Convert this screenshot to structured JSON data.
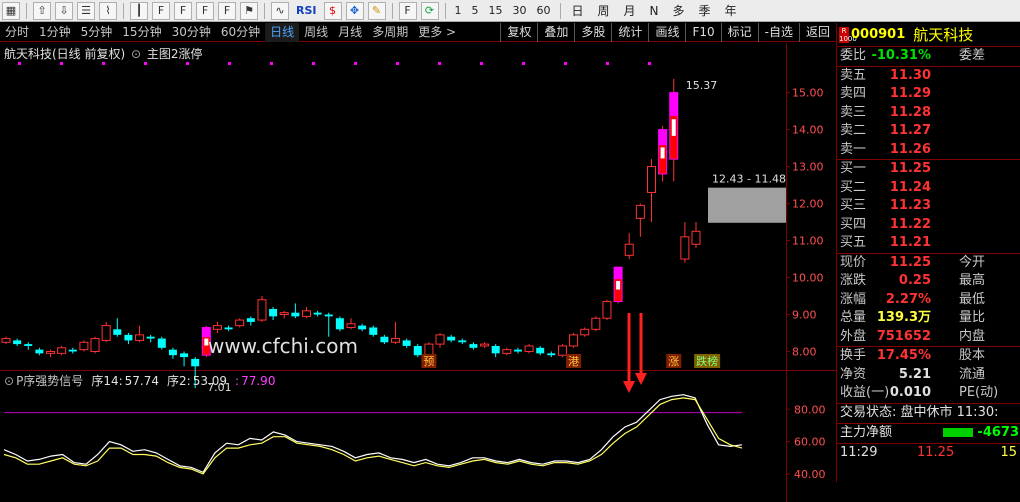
{
  "toolbar": {
    "icons": [
      "grid-icon",
      "arrow-up-icon",
      "arrow-down-icon",
      "list-icon",
      "line-chart-icon",
      "candle-icon",
      "f10-icon",
      "fa-icon",
      "fz-icon",
      "fc-icon",
      "flag-icon",
      "sparkline-icon",
      "rsi-icon",
      "dollar-icon",
      "move-icon",
      "pencil-icon",
      "f5-icon",
      "refresh-icon"
    ],
    "rsi_label": "RSI",
    "periods": [
      "1",
      "5",
      "15",
      "30",
      "60"
    ],
    "ranges": [
      "日",
      "周",
      "月",
      "N",
      "多",
      "季",
      "年"
    ]
  },
  "period_bar": {
    "items": [
      "分时",
      "1分钟",
      "5分钟",
      "15分钟",
      "30分钟",
      "60分钟",
      "日线",
      "周线",
      "月线",
      "多周期",
      "更多 >"
    ],
    "active_index": 6,
    "buttons": [
      "复权",
      "叠加",
      "多股",
      "统计",
      "画线",
      "F10",
      "标记",
      "-自选",
      "返回"
    ]
  },
  "chart_header": {
    "stock_title": "航天科技(日线 前复权)",
    "main_label": "主图2涨停"
  },
  "watermark": "www.cfchi.com",
  "chart_data": {
    "type": "candlestick",
    "price_axis": {
      "ticks": [
        "15.00",
        "14.00",
        "13.00",
        "12.00",
        "11.00",
        "10.00",
        "9.00",
        "8.00"
      ],
      "ylim": [
        7.5,
        15.8
      ]
    },
    "high_label": "15.37",
    "low_label": "7.01",
    "gap_label": "12.43 - 11.48",
    "gap_range": [
      11.48,
      12.43
    ],
    "markers": [
      "预",
      "港",
      "涨",
      "跌榜"
    ],
    "candles": [
      {
        "o": 8.25,
        "c": 8.35,
        "h": 8.4,
        "l": 8.2
      },
      {
        "o": 8.3,
        "c": 8.2,
        "h": 8.35,
        "l": 8.15
      },
      {
        "o": 8.2,
        "c": 8.15,
        "h": 8.25,
        "l": 8.05
      },
      {
        "o": 8.05,
        "c": 7.95,
        "h": 8.1,
        "l": 7.9
      },
      {
        "o": 7.95,
        "c": 8.0,
        "h": 8.05,
        "l": 7.85
      },
      {
        "o": 7.95,
        "c": 8.1,
        "h": 8.15,
        "l": 7.9
      },
      {
        "o": 8.05,
        "c": 8.0,
        "h": 8.1,
        "l": 7.95
      },
      {
        "o": 8.05,
        "c": 8.25,
        "h": 8.3,
        "l": 8.0
      },
      {
        "o": 8.0,
        "c": 8.35,
        "h": 8.4,
        "l": 7.95
      },
      {
        "o": 8.3,
        "c": 8.7,
        "h": 8.8,
        "l": 8.25
      },
      {
        "o": 8.6,
        "c": 8.45,
        "h": 8.9,
        "l": 8.4
      },
      {
        "o": 8.45,
        "c": 8.3,
        "h": 8.5,
        "l": 8.2
      },
      {
        "o": 8.3,
        "c": 8.45,
        "h": 8.7,
        "l": 8.25
      },
      {
        "o": 8.4,
        "c": 8.35,
        "h": 8.45,
        "l": 8.25
      },
      {
        "o": 8.35,
        "c": 8.1,
        "h": 8.4,
        "l": 8.05
      },
      {
        "o": 8.05,
        "c": 7.9,
        "h": 8.1,
        "l": 7.8
      },
      {
        "o": 7.95,
        "c": 7.85,
        "h": 8.0,
        "l": 7.6
      },
      {
        "o": 7.8,
        "c": 7.6,
        "h": 7.85,
        "l": 7.01
      },
      {
        "o": 7.9,
        "c": 8.65,
        "h": 8.7,
        "l": 7.85
      },
      {
        "o": 8.6,
        "c": 8.7,
        "h": 8.8,
        "l": 8.5
      },
      {
        "o": 8.65,
        "c": 8.6,
        "h": 8.7,
        "l": 8.55
      },
      {
        "o": 8.7,
        "c": 8.85,
        "h": 8.9,
        "l": 8.65
      },
      {
        "o": 8.9,
        "c": 8.8,
        "h": 8.95,
        "l": 8.7
      },
      {
        "o": 8.85,
        "c": 9.4,
        "h": 9.5,
        "l": 8.8
      },
      {
        "o": 9.15,
        "c": 8.95,
        "h": 9.2,
        "l": 8.85
      },
      {
        "o": 9.0,
        "c": 9.05,
        "h": 9.1,
        "l": 8.9
      },
      {
        "o": 9.05,
        "c": 8.95,
        "h": 9.3,
        "l": 8.9
      },
      {
        "o": 8.95,
        "c": 9.1,
        "h": 9.2,
        "l": 8.9
      },
      {
        "o": 9.05,
        "c": 9.0,
        "h": 9.1,
        "l": 8.95
      },
      {
        "o": 9.0,
        "c": 8.95,
        "h": 9.05,
        "l": 8.4
      },
      {
        "o": 8.9,
        "c": 8.6,
        "h": 8.95,
        "l": 8.55
      },
      {
        "o": 8.65,
        "c": 8.75,
        "h": 8.9,
        "l": 8.6
      },
      {
        "o": 8.7,
        "c": 8.6,
        "h": 8.75,
        "l": 8.55
      },
      {
        "o": 8.65,
        "c": 8.45,
        "h": 8.7,
        "l": 8.4
      },
      {
        "o": 8.4,
        "c": 8.25,
        "h": 8.45,
        "l": 8.2
      },
      {
        "o": 8.25,
        "c": 8.35,
        "h": 8.8,
        "l": 8.2
      },
      {
        "o": 8.3,
        "c": 8.15,
        "h": 8.35,
        "l": 8.1
      },
      {
        "o": 8.15,
        "c": 7.9,
        "h": 8.2,
        "l": 7.85
      },
      {
        "o": 7.9,
        "c": 8.2,
        "h": 8.25,
        "l": 7.85
      },
      {
        "o": 8.2,
        "c": 8.45,
        "h": 8.5,
        "l": 8.1
      },
      {
        "o": 8.4,
        "c": 8.3,
        "h": 8.45,
        "l": 8.25
      },
      {
        "o": 8.3,
        "c": 8.25,
        "h": 8.35,
        "l": 8.2
      },
      {
        "o": 8.2,
        "c": 8.1,
        "h": 8.25,
        "l": 8.05
      },
      {
        "o": 8.15,
        "c": 8.2,
        "h": 8.25,
        "l": 8.1
      },
      {
        "o": 8.15,
        "c": 7.95,
        "h": 8.2,
        "l": 7.85
      },
      {
        "o": 7.95,
        "c": 8.05,
        "h": 8.1,
        "l": 7.9
      },
      {
        "o": 8.05,
        "c": 8.0,
        "h": 8.1,
        "l": 7.95
      },
      {
        "o": 8.0,
        "c": 8.15,
        "h": 8.2,
        "l": 7.95
      },
      {
        "o": 8.1,
        "c": 7.95,
        "h": 8.15,
        "l": 7.9
      },
      {
        "o": 7.95,
        "c": 7.9,
        "h": 8.0,
        "l": 7.85
      },
      {
        "o": 7.9,
        "c": 8.15,
        "h": 8.2,
        "l": 7.85
      },
      {
        "o": 8.15,
        "c": 8.45,
        "h": 8.5,
        "l": 8.1
      },
      {
        "o": 8.45,
        "c": 8.6,
        "h": 8.65,
        "l": 8.4
      },
      {
        "o": 8.6,
        "c": 8.9,
        "h": 8.95,
        "l": 8.55
      },
      {
        "o": 8.9,
        "c": 9.35,
        "h": 9.4,
        "l": 8.85
      },
      {
        "o": 9.35,
        "c": 10.28,
        "h": 10.28,
        "l": 9.3
      },
      {
        "o": 10.6,
        "c": 10.9,
        "h": 11.2,
        "l": 10.5
      },
      {
        "o": 11.6,
        "c": 11.95,
        "h": 12.0,
        "l": 11.1
      },
      {
        "o": 12.3,
        "c": 13.0,
        "h": 13.2,
        "l": 11.5
      },
      {
        "o": 12.8,
        "c": 14.0,
        "h": 14.1,
        "l": 12.6
      },
      {
        "o": 13.2,
        "c": 15.0,
        "h": 15.37,
        "l": 12.6
      },
      {
        "o": 10.5,
        "c": 11.1,
        "h": 11.5,
        "l": 10.4
      },
      {
        "o": 10.9,
        "c": 11.25,
        "h": 11.5,
        "l": 10.8
      }
    ],
    "indicator": {
      "name": "P序强势信号",
      "items": [
        {
          "label": "序14:",
          "value": "57.74"
        },
        {
          "label": "序2:",
          "value": "53.09"
        },
        {
          "label": ":",
          "value": "77.90"
        }
      ],
      "ylim": [
        35,
        95
      ],
      "ticks": [
        "80.00",
        "60.00",
        "40.00"
      ],
      "hline": 77.9,
      "series": [
        {
          "values": [
            55,
            52,
            48,
            49,
            51,
            52,
            47,
            46,
            52,
            60,
            58,
            54,
            55,
            53,
            49,
            45,
            44,
            41,
            53,
            59,
            58,
            62,
            61,
            66,
            64,
            60,
            59,
            58,
            57,
            54,
            50,
            52,
            53,
            50,
            49,
            47,
            49,
            46,
            45,
            47,
            50,
            50,
            48,
            47,
            49,
            47,
            46,
            48,
            48,
            47,
            49,
            55,
            63,
            69,
            72,
            79,
            86,
            88,
            89,
            87,
            71,
            58,
            57,
            58
          ]
        },
        {
          "values": [
            52,
            50,
            46,
            46,
            48,
            50,
            46,
            45,
            48,
            56,
            56,
            52,
            52,
            51,
            47,
            44,
            43,
            40,
            50,
            56,
            56,
            58,
            59,
            63,
            63,
            59,
            58,
            57,
            55,
            52,
            48,
            50,
            51,
            49,
            47,
            45,
            47,
            45,
            44,
            46,
            48,
            49,
            47,
            46,
            48,
            46,
            45,
            47,
            47,
            46,
            48,
            52,
            59,
            65,
            69,
            76,
            83,
            86,
            87,
            86,
            74,
            62,
            58,
            56
          ]
        }
      ]
    }
  },
  "quote": {
    "code": "000901",
    "name": "航天科技",
    "wei_bi": {
      "label": "委比",
      "value": "-10.31%",
      "label2": "委差"
    },
    "sells": [
      {
        "label": "卖五",
        "price": "11.30"
      },
      {
        "label": "卖四",
        "price": "11.29"
      },
      {
        "label": "卖三",
        "price": "11.28"
      },
      {
        "label": "卖二",
        "price": "11.27"
      },
      {
        "label": "卖一",
        "price": "11.26"
      }
    ],
    "buys": [
      {
        "label": "买一",
        "price": "11.25"
      },
      {
        "label": "买二",
        "price": "11.24"
      },
      {
        "label": "买三",
        "price": "11.23"
      },
      {
        "label": "买四",
        "price": "11.22"
      },
      {
        "label": "买五",
        "price": "11.21"
      }
    ],
    "stats": [
      {
        "label": "现价",
        "value": "11.25",
        "label2": "今开"
      },
      {
        "label": "涨跌",
        "value": "0.25",
        "label2": "最高"
      },
      {
        "label": "涨幅",
        "value": "2.27%",
        "label2": "最低"
      },
      {
        "label": "总量",
        "value": "139.3万",
        "label2": "量比"
      },
      {
        "label": "外盘",
        "value": "751652",
        "label2": "内盘"
      }
    ],
    "stats2": [
      {
        "label": "换手",
        "value": "17.45%",
        "label2": "股本"
      },
      {
        "label": "净资",
        "value": "5.21",
        "label2": "流通"
      },
      {
        "label": "收益(一)",
        "value": "0.010",
        "label2": "PE(动)"
      }
    ],
    "trade_state": "交易状态: 盘中休市 11:30:",
    "main_flow": {
      "label": "主力净额",
      "value": "-4673"
    },
    "tick": {
      "time": "11:29",
      "price": "11.25",
      "vol": "15"
    }
  },
  "colors": {
    "up": "#ff3232",
    "down": "#00ffff",
    "limit": "#ff00ff",
    "gap": "#a0a0a0"
  }
}
